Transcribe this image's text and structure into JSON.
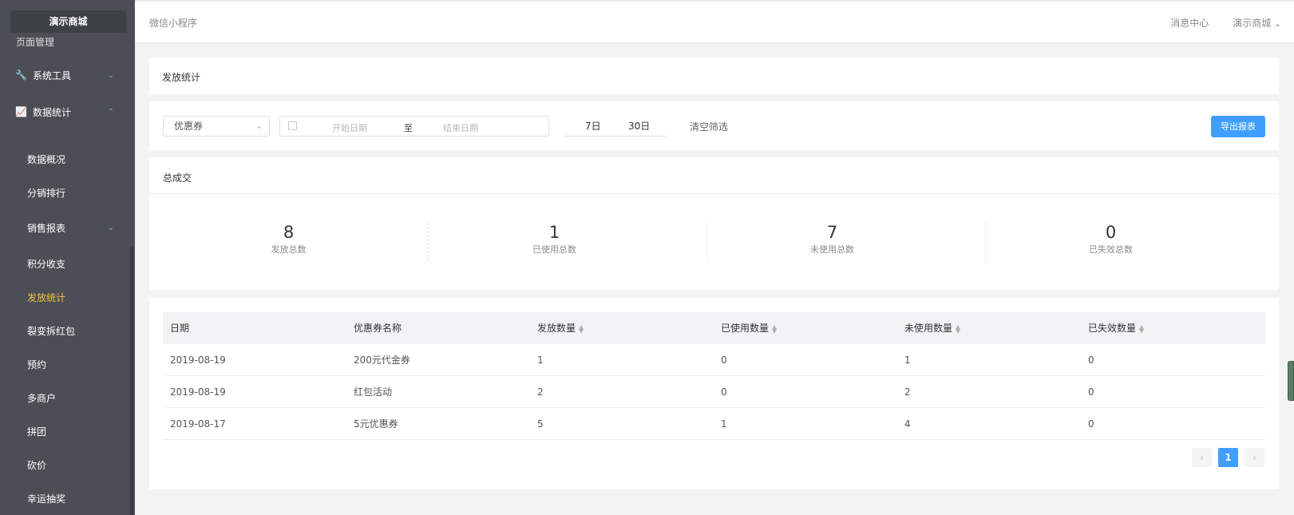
{
  "sidebar": {
    "brand": "演示商城",
    "clipped_item": "页面管理",
    "groups": [
      {
        "label": "系统工具",
        "icon": "wrench-icon"
      },
      {
        "label": "数据统计",
        "icon": "line-chart-icon"
      }
    ],
    "items": [
      {
        "label": "数据概况"
      },
      {
        "label": "分销排行"
      },
      {
        "label": "销售报表"
      },
      {
        "label": "积分收支"
      },
      {
        "label": "发放统计",
        "active": true
      },
      {
        "label": "裂变拆红包"
      },
      {
        "label": "预约"
      },
      {
        "label": "多商户"
      },
      {
        "label": "拼团"
      },
      {
        "label": "砍价"
      },
      {
        "label": "幸运抽奖"
      }
    ]
  },
  "header": {
    "left": "微信小程序",
    "messages": "消息中心",
    "store": "演示商城"
  },
  "page_title": "发放统计",
  "filter": {
    "type_value": "优惠券",
    "start_placeholder": "开始日期",
    "to": "至",
    "end_placeholder": "结束日期",
    "quick_7": "7日",
    "quick_30": "30日",
    "clear": "清空筛选",
    "export": "导出报表"
  },
  "totals": {
    "title": "总成交",
    "stats": [
      {
        "value": "8",
        "label": "发放总数"
      },
      {
        "value": "1",
        "label": "已使用总数"
      },
      {
        "value": "7",
        "label": "未使用总数"
      },
      {
        "value": "0",
        "label": "已失效总数"
      }
    ]
  },
  "table": {
    "columns": [
      "日期",
      "优惠券名称",
      "发放数量",
      "已使用数量",
      "未使用数量",
      "已失效数量"
    ],
    "rows": [
      [
        "2019-08-19",
        "200元代金券",
        "1",
        "0",
        "1",
        "0"
      ],
      [
        "2019-08-19",
        "红包活动",
        "2",
        "0",
        "2",
        "0"
      ],
      [
        "2019-08-17",
        "5元优惠券",
        "5",
        "1",
        "4",
        "0"
      ]
    ]
  },
  "pagination": {
    "prev": "‹",
    "current": "1",
    "next": "›"
  },
  "colors": {
    "sidebar_bg": "#4b4f55",
    "active_menu": "#f6c243",
    "primary": "#409eff"
  }
}
